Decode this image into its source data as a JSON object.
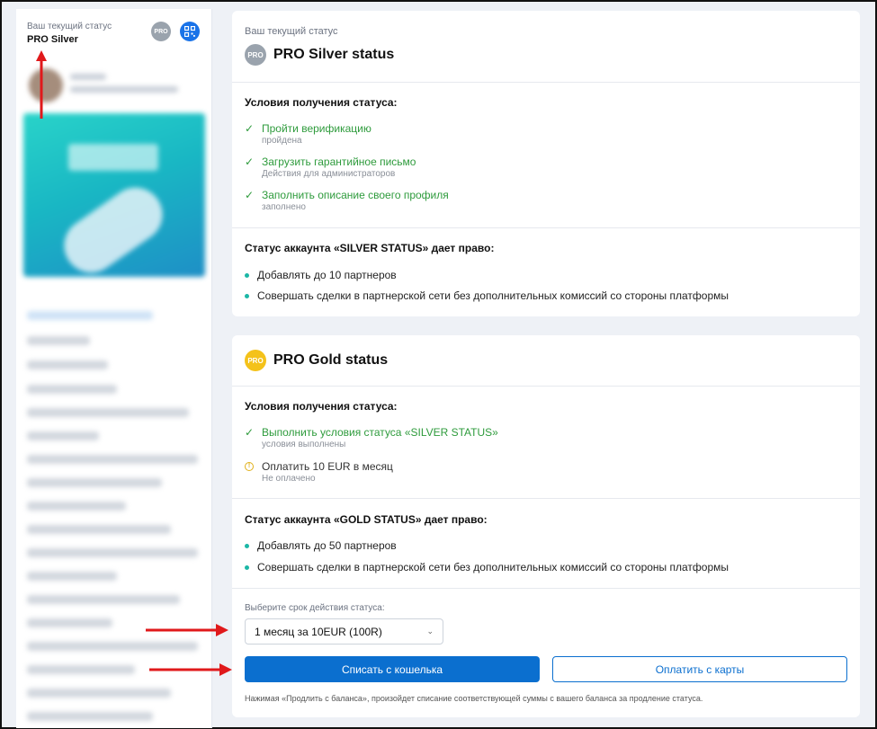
{
  "sidebar": {
    "status_label": "Ваш текущий статус",
    "status_value": "PRO Silver",
    "pro_badge": "PRO",
    "qr_icon": "qr-code-icon"
  },
  "silver": {
    "label": "Ваш текущий статус",
    "badge": "PRO",
    "title": "PRO Silver status",
    "conditions_title": "Условия получения статуса:",
    "conditions": [
      {
        "text": "Пройти верификацию",
        "sub": "пройдена",
        "state": "done"
      },
      {
        "text": "Загрузить гарантийное письмо",
        "sub": "Действия для администраторов",
        "state": "done"
      },
      {
        "text": "Заполнить описание своего профиля",
        "sub": "заполнено",
        "state": "done"
      }
    ],
    "rights_title": "Статус аккаунта «SILVER STATUS» дает право:",
    "rights": [
      "Добавлять до 10 партнеров",
      "Совершать сделки в партнерской сети без дополнительных комиссий со стороны платформы"
    ]
  },
  "gold": {
    "badge": "PRO",
    "title": "PRO Gold status",
    "conditions_title": "Условия получения статуса:",
    "conditions": [
      {
        "text": "Выполнить условия статуса «SILVER STATUS»",
        "sub": "условия выполнены",
        "state": "done"
      },
      {
        "text": "Оплатить 10 EUR в месяц",
        "sub": "Не оплачено",
        "state": "pending"
      }
    ],
    "rights_title": "Статус аккаунта «GOLD STATUS» дает право:",
    "rights": [
      "Добавлять до 50 партнеров",
      "Совершать сделки в партнерской сети без дополнительных комиссий со стороны платформы"
    ],
    "select_label": "Выберите срок действия статуса:",
    "select_value": "1 месяц за 10EUR (100R)",
    "wallet_button": "Списать с кошелька",
    "card_button": "Оплатить с карты",
    "note": "Нажимая «Продлить с баланса», произойдет списание соответствующей суммы с вашего баланса за продление статуса."
  },
  "colors": {
    "primary": "#0b6fcf",
    "success": "#2e9b3c",
    "warning": "#e0b01b",
    "bullet": "#1cb7a6",
    "annotation_arrow": "#e0191b"
  }
}
